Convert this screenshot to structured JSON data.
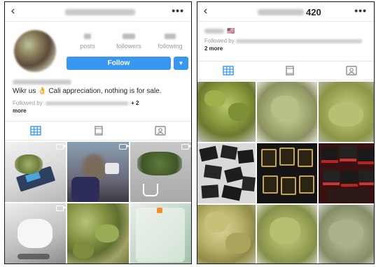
{
  "left_profile": {
    "back_icon": "chevron-left-icon",
    "more_label": "•••",
    "stats": [
      {
        "label": "posts"
      },
      {
        "label": "followers"
      },
      {
        "label": "following"
      }
    ],
    "follow_label": "Follow",
    "dropdown_label": "▼",
    "bio_text": "Wikr us 👌 Cali appreciation, nothing is for sale.",
    "followed_by_prefix": "Followed by",
    "followed_by_suffix": "+ 2",
    "followed_by_more": "more",
    "tabs": [
      "grid-icon",
      "feed-icon",
      "tagged-icon"
    ],
    "posts": [
      {
        "kind": "scale",
        "video": true
      },
      {
        "kind": "person",
        "video": true
      },
      {
        "kind": "plant-jar",
        "video": true
      },
      {
        "kind": "hand-glove",
        "video": true
      },
      {
        "kind": "buds",
        "video": false
      },
      {
        "kind": "phone-buds",
        "video": false
      }
    ]
  },
  "right_profile": {
    "back_icon": "chevron-left-icon",
    "more_label": "•••",
    "title_suffix": "420",
    "flag_emoji": "🇺🇸",
    "followed_by_prefix": "Followed by",
    "followed_by_more": "2 more",
    "tabs": [
      "grid-icon",
      "feed-icon",
      "tagged-icon"
    ],
    "posts": [
      {
        "kind": "buds-tray"
      },
      {
        "kind": "buds-pile"
      },
      {
        "kind": "buds-light"
      },
      {
        "kind": "bags-dark"
      },
      {
        "kind": "bags-gold"
      },
      {
        "kind": "bags-red"
      },
      {
        "kind": "buds-yellow"
      },
      {
        "kind": "buds-green"
      },
      {
        "kind": "buds-grey"
      }
    ]
  }
}
